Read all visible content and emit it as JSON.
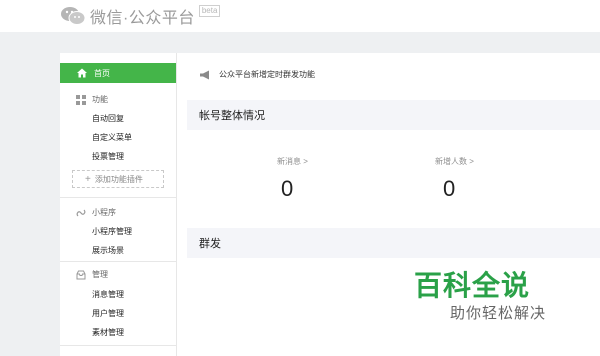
{
  "header": {
    "logo_text": "微信·公众平台",
    "beta": "beta"
  },
  "sidebar": {
    "home": "首页",
    "groups": [
      {
        "title": "功能",
        "icon": "grid-icon",
        "items": [
          "自动回复",
          "自定义菜单",
          "投票管理"
        ]
      },
      {
        "title": "小程序",
        "icon": "mini-program-icon",
        "items": [
          "小程序管理",
          "展示场景"
        ]
      },
      {
        "title": "管理",
        "icon": "inbox-icon",
        "items": [
          "消息管理",
          "用户管理",
          "素材管理"
        ]
      }
    ],
    "plugin_button": "添加功能插件"
  },
  "main": {
    "notice": "公众平台新增定时群发功能",
    "overview_title": "帐号整体情况",
    "stats": [
      {
        "label": "新消息",
        "value": "0"
      },
      {
        "label": "新增人数",
        "value": "0"
      }
    ],
    "mass_send_title": "群发"
  },
  "watermark": {
    "big": "百科全说",
    "small": "助你轻松解决"
  },
  "colors": {
    "accent": "#44b549",
    "panel_bg": "#f4f5f9"
  }
}
